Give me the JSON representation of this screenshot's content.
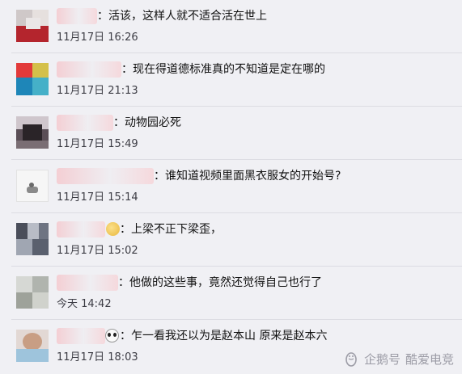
{
  "comments": [
    {
      "text": "：活该，这样人就不适合活在世上",
      "time": "11月17日 16:26"
    },
    {
      "text": "：现在得道德标准真的不知道是定在哪的",
      "time": "11月17日 21:13"
    },
    {
      "text": "：动物园必死",
      "time": "11月17日 15:49"
    },
    {
      "text": "：谁知道视频里面黑衣服女的开始号?",
      "time": "11月17日 15:14"
    },
    {
      "text": "：上梁不正下梁歪，",
      "time": "11月17日 15:02"
    },
    {
      "text": "：他做的这些事，竟然还觉得自己也行了",
      "time": "今天 14:42"
    },
    {
      "text": "：乍一看我还以为是赵本山 原来是赵本六",
      "time": "11月17日 18:03"
    }
  ],
  "watermark": {
    "brand": "企鹅号",
    "account": "酷爱电竞"
  },
  "icons": {
    "watermark": "penguin-icon",
    "row5_emoji": "smiley-emoji-icon",
    "row7_emoji": "panda-emoji-icon"
  }
}
